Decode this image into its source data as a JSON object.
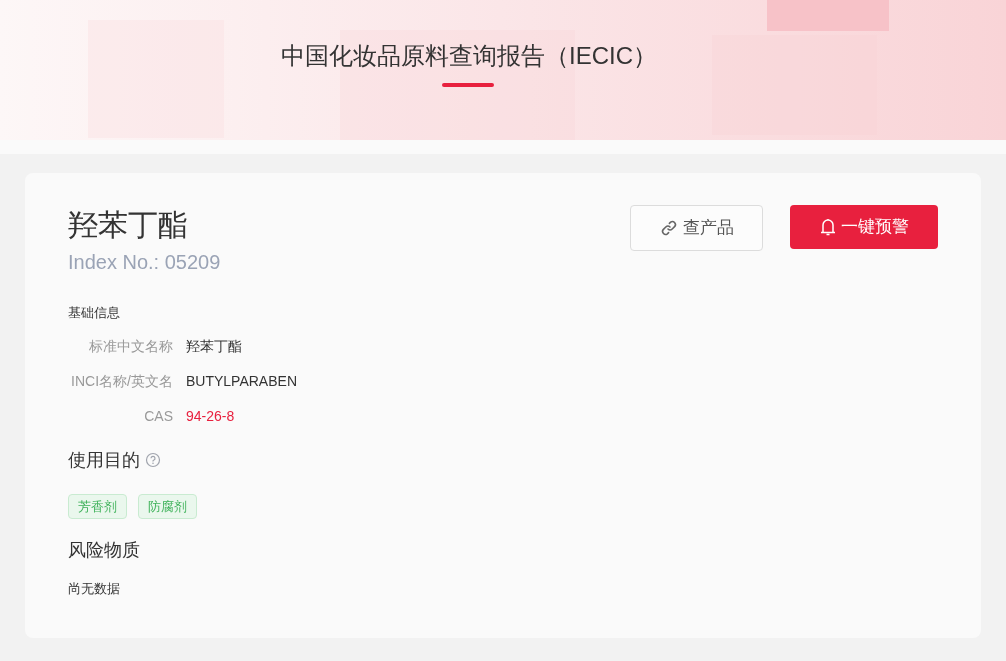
{
  "header": {
    "title": "中国化妆品原料查询报告（IECIC）"
  },
  "ingredient": {
    "name": "羟苯丁酯",
    "index_no": "Index No.: 05209"
  },
  "buttons": [
    {
      "kind": "outline",
      "label": "查产品"
    },
    {
      "kind": "primary",
      "label": "一键预警"
    }
  ],
  "basic_info": {
    "heading": "基础信息",
    "fields": [
      {
        "label": "标准中文名称",
        "value": "羟苯丁酯",
        "kind": "text"
      },
      {
        "label": "INCI名称/英文名",
        "value": "BUTYLPARABEN",
        "kind": "text"
      },
      {
        "label": "CAS",
        "value": "94-26-8",
        "kind": "link"
      }
    ]
  },
  "purpose": {
    "heading": "使用目的",
    "tags": [
      "芳香剂",
      "防腐剂"
    ]
  },
  "risk": {
    "heading": "风险物质",
    "empty_text": "尚无数据"
  }
}
